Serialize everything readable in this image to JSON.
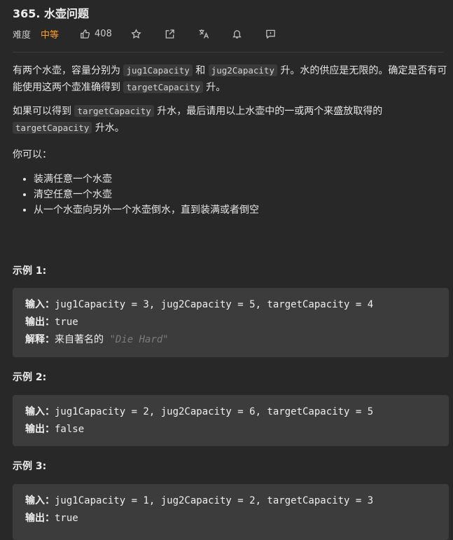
{
  "problem": {
    "title": "365. 水壶问题",
    "difficulty_label": "难度",
    "difficulty": "中等",
    "likes": "408"
  },
  "description": {
    "p1_a": "有两个水壶，容量分别为",
    "p1_code1": "jug1Capacity",
    "p1_b": "和",
    "p1_code2": "jug2Capacity",
    "p1_c": "升。水的供应是无限的。确定是否有可能使用这两个壶准确得到",
    "p1_code3": "targetCapacity",
    "p1_d": "升。",
    "p2_a": "如果可以得到",
    "p2_code1": "targetCapacity",
    "p2_b": "升水，最后请用以上水壶中的一或两个来盛放取得的",
    "p2_code2": "targetCapacity",
    "p2_c": "升水。",
    "p3": "你可以：",
    "list": [
      "装满任意一个水壶",
      "清空任意一个水壶",
      "从一个水壶向另外一个水壶倒水，直到装满或者倒空"
    ]
  },
  "examples": [
    {
      "title": "示例 1:",
      "input_label": "输入：",
      "input": "jug1Capacity = 3, jug2Capacity = 5, targetCapacity = 4",
      "output_label": "输出：",
      "output": "true",
      "explain_label": "解释：",
      "explain_text": "来自著名的",
      "explain_quote": "\"Die Hard\""
    },
    {
      "title": "示例 2:",
      "input_label": "输入：",
      "input": "jug1Capacity = 2, jug2Capacity = 6, targetCapacity = 5",
      "output_label": "输出：",
      "output": "false"
    },
    {
      "title": "示例 3:",
      "input_label": "输入：",
      "input": "jug1Capacity = 1, jug2Capacity = 2, targetCapacity = 3",
      "output_label": "输出：",
      "output": "true"
    }
  ],
  "icons": [
    "thumbs-up-icon",
    "star-icon",
    "share-icon",
    "translate-icon",
    "bell-icon",
    "feedback-icon"
  ],
  "colors": {
    "accent": "#ffa116",
    "background": "#282828",
    "code_block": "#3c3c3c"
  }
}
